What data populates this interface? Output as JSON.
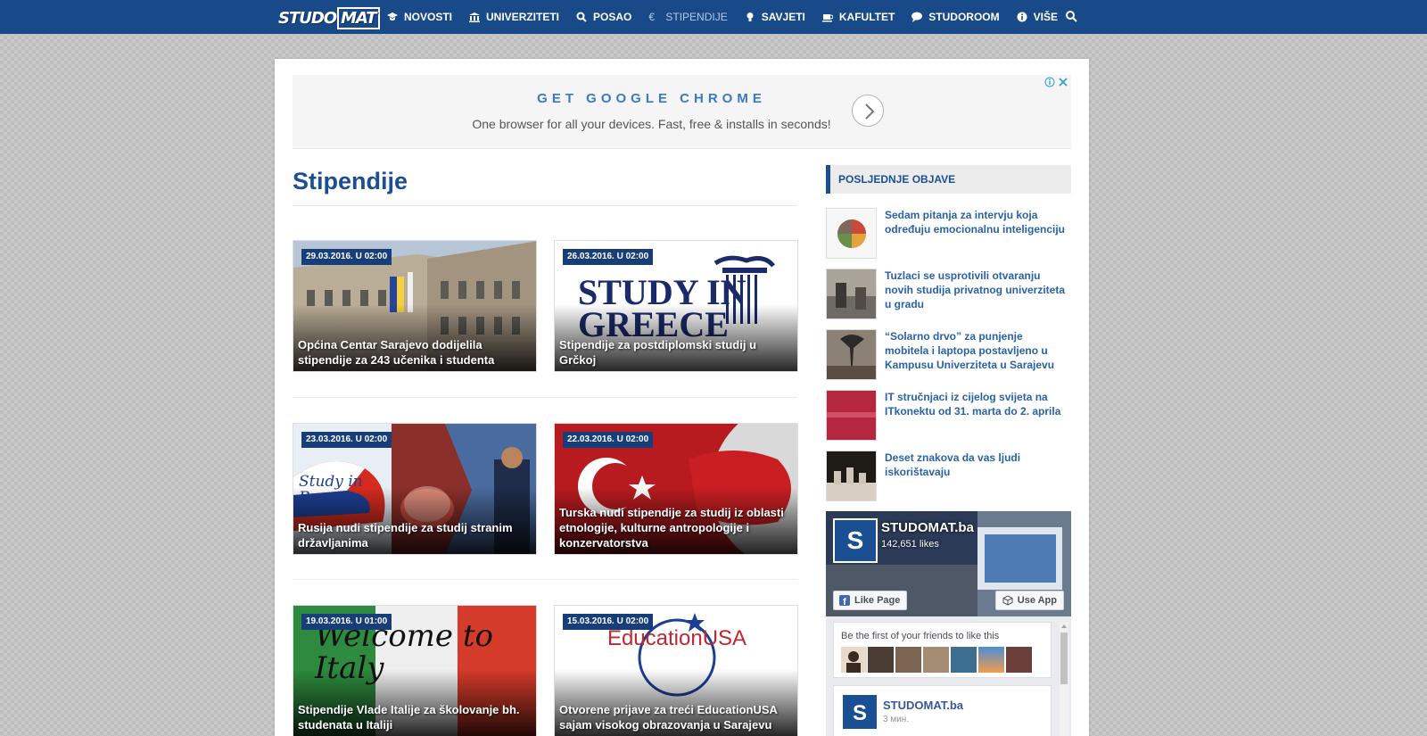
{
  "brand": {
    "logo_left": "STUDO",
    "logo_right": "MAT"
  },
  "nav": {
    "items": [
      {
        "label": "NOVOSTI",
        "icon": "mortarboard-icon"
      },
      {
        "label": "UNIVERZITETI",
        "icon": "institution-icon"
      },
      {
        "label": "POSAO",
        "icon": "search-icon"
      },
      {
        "label": "STIPENDIJE",
        "icon": "euro-icon",
        "active": true
      },
      {
        "label": "SAVJETI",
        "icon": "lightbulb-icon"
      },
      {
        "label": "KAFULTET",
        "icon": "coffee-icon"
      },
      {
        "label": "STUDOROOM",
        "icon": "chat-icon"
      },
      {
        "label": "VIŠE",
        "icon": "info-icon"
      }
    ]
  },
  "ad": {
    "title": "GET GOOGLE CHROME",
    "subtitle": "One browser for all your devices. Fast, free & installs in seconds!"
  },
  "page": {
    "title": "Stipendije"
  },
  "articles": [
    {
      "date": "29.03.2016. U 02:00",
      "title": "Općina Centar Sarajevo dodijelila stipendije za 243 učenika i studenta"
    },
    {
      "date": "26.03.2016. U 02:00",
      "title": "Stipendije za postdiplomski studij u Grčkoj",
      "image_text": "STUDY IN GREECE"
    },
    {
      "date": "23.03.2016. U 02:00",
      "title": "Rusija nudi stipendije za studij stranim državljanima",
      "image_text": "Study in Russia"
    },
    {
      "date": "22.03.2016. U 02:00",
      "title": "Turska nudi stipendije za studij iz oblasti etnologije, kulturne antropologije i konzervatorstva"
    },
    {
      "date": "19.03.2016. U 01:00",
      "title": "Stipendije Vlade Italije za školovanje bh. studenata u Italiji",
      "image_text": "Welcome to Italy"
    },
    {
      "date": "15.03.2016. U 02:00",
      "title": "Otvorene prijave za treći EducationUSA sajam visokog obrazovanja u Sarajevu",
      "image_text": "EducationUSA"
    }
  ],
  "sidebar": {
    "heading": "POSLJEDNJE OBJAVE",
    "posts": [
      {
        "title": "Sedam pitanja za intervju koja određuju emocionalnu inteligenciju"
      },
      {
        "title": "Tuzlaci se usprotivili otvaranju novih studija privatnog univerziteta u gradu"
      },
      {
        "title": "“Solarno drvo” za punjenje mobitela i laptopa postavljeno u Kampusu Univerziteta u Sarajevu"
      },
      {
        "title": "IT stručnjaci iz cijelog svijeta na ITkonektu od 31. marta do 2. aprila"
      },
      {
        "title": "Deset znakova da vas ljudi iskorištavaju"
      }
    ]
  },
  "facebook": {
    "page_name": "STUDOMAT.ba",
    "likes": "142,651 likes",
    "like_button": "Like Page",
    "app_button": "Use App",
    "friends_text": "Be the first of your friends to like this",
    "post_name": "STUDOMAT.ba",
    "post_time": "3 мин."
  },
  "colors": {
    "nav_bg": "#184a8a",
    "accent": "#1b4f93",
    "link": "#2a62a8",
    "date_badge": "#173e78"
  }
}
